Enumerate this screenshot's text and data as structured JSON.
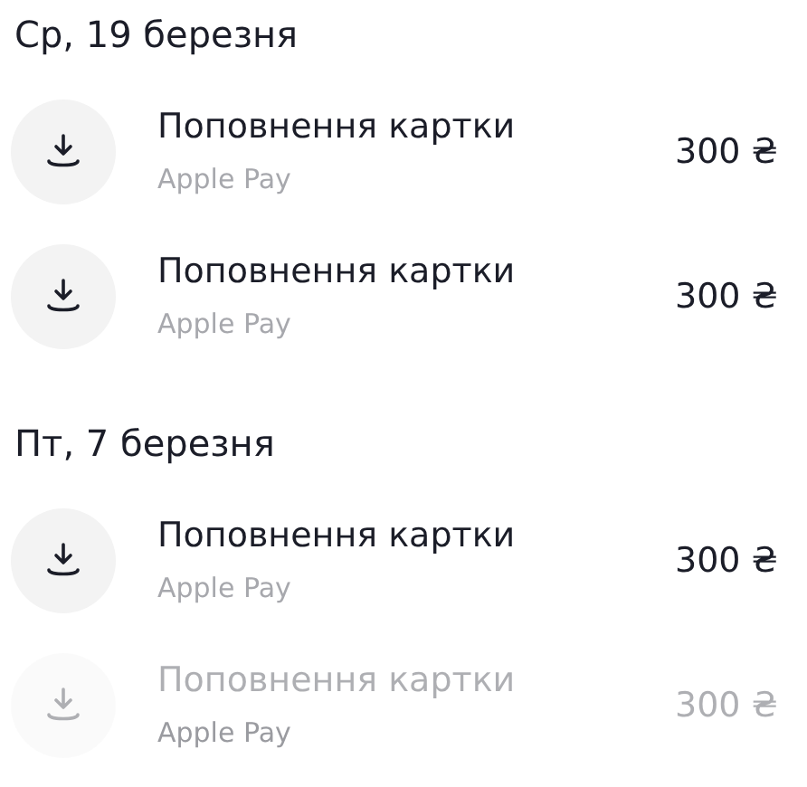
{
  "sections": [
    {
      "date": "Ср, 19 березня",
      "transactions": [
        {
          "title": "Поповнення картки",
          "subtitle": "Apple Pay",
          "amount": "300 ₴",
          "faded": false
        },
        {
          "title": "Поповнення картки",
          "subtitle": "Apple Pay",
          "amount": "300 ₴",
          "faded": false
        }
      ]
    },
    {
      "date": "Пт, 7 березня",
      "transactions": [
        {
          "title": "Поповнення картки",
          "subtitle": "Apple Pay",
          "amount": "300 ₴",
          "faded": false
        },
        {
          "title": "Поповнення картки",
          "subtitle": "Apple Pay",
          "amount": "300 ₴",
          "faded": true
        }
      ]
    }
  ]
}
